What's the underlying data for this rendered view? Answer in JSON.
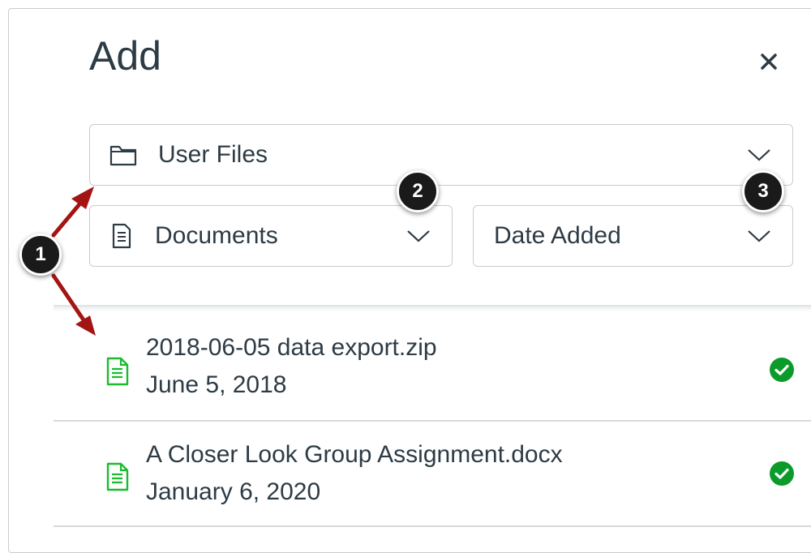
{
  "panel": {
    "title": "Add",
    "close_label": "×"
  },
  "filters": {
    "usage": {
      "selected": "User Files",
      "icon": "folder-icon"
    },
    "content_type": {
      "selected": "Documents",
      "icon": "document-icon"
    },
    "sort": {
      "selected": "Date Added"
    }
  },
  "files": [
    {
      "name": "2018-06-05 data export.zip",
      "date": "June 5, 2018",
      "icon": "file-document-icon",
      "status": "check-circle-icon"
    },
    {
      "name": "A Closer Look Group Assignment.docx",
      "date": "January 6, 2020",
      "icon": "file-document-icon",
      "status": "check-circle-icon"
    }
  ],
  "callouts": [
    "1",
    "2",
    "3"
  ],
  "colors": {
    "text": "#2d3b45",
    "border": "#c7cdd1",
    "file_icon": "#1bbb2f",
    "check": "#0b9b2a",
    "callout": "#1a1a1a",
    "arrow": "#a31515"
  }
}
